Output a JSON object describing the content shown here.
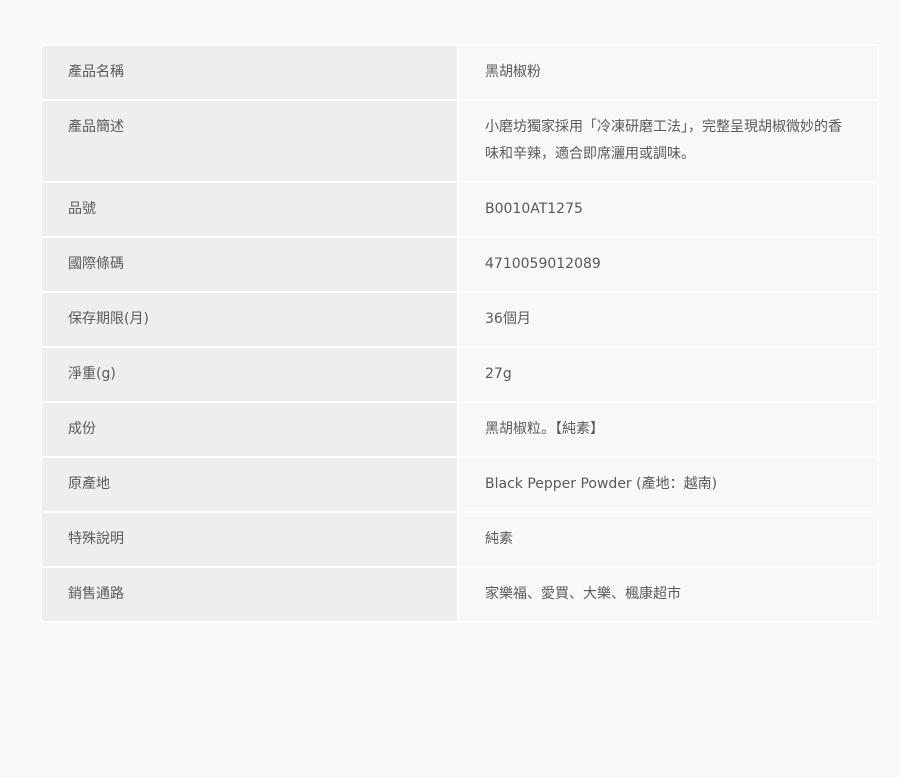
{
  "spec": {
    "rows": [
      {
        "label": "產品名稱",
        "value": "黑胡椒粉"
      },
      {
        "label": "產品簡述",
        "value": "小磨坊獨家採用「冷凍研磨工法」，完整呈現胡椒微妙的香味和辛辣，適合即席灑用或調味。"
      },
      {
        "label": "品號",
        "value": "B0010AT1275"
      },
      {
        "label": "國際條碼",
        "value": "4710059012089"
      },
      {
        "label": "保存期限(月)",
        "value": "36個月"
      },
      {
        "label": "淨重(g)",
        "value": "27g"
      },
      {
        "label": "成份",
        "value": "黑胡椒粒。【純素】"
      },
      {
        "label": "原產地",
        "value": "Black Pepper Powder (產地：越南)"
      },
      {
        "label": "特殊說明",
        "value": "純素"
      },
      {
        "label": "銷售通路",
        "value": "家樂福、愛買、大樂、楓康超市"
      }
    ]
  }
}
